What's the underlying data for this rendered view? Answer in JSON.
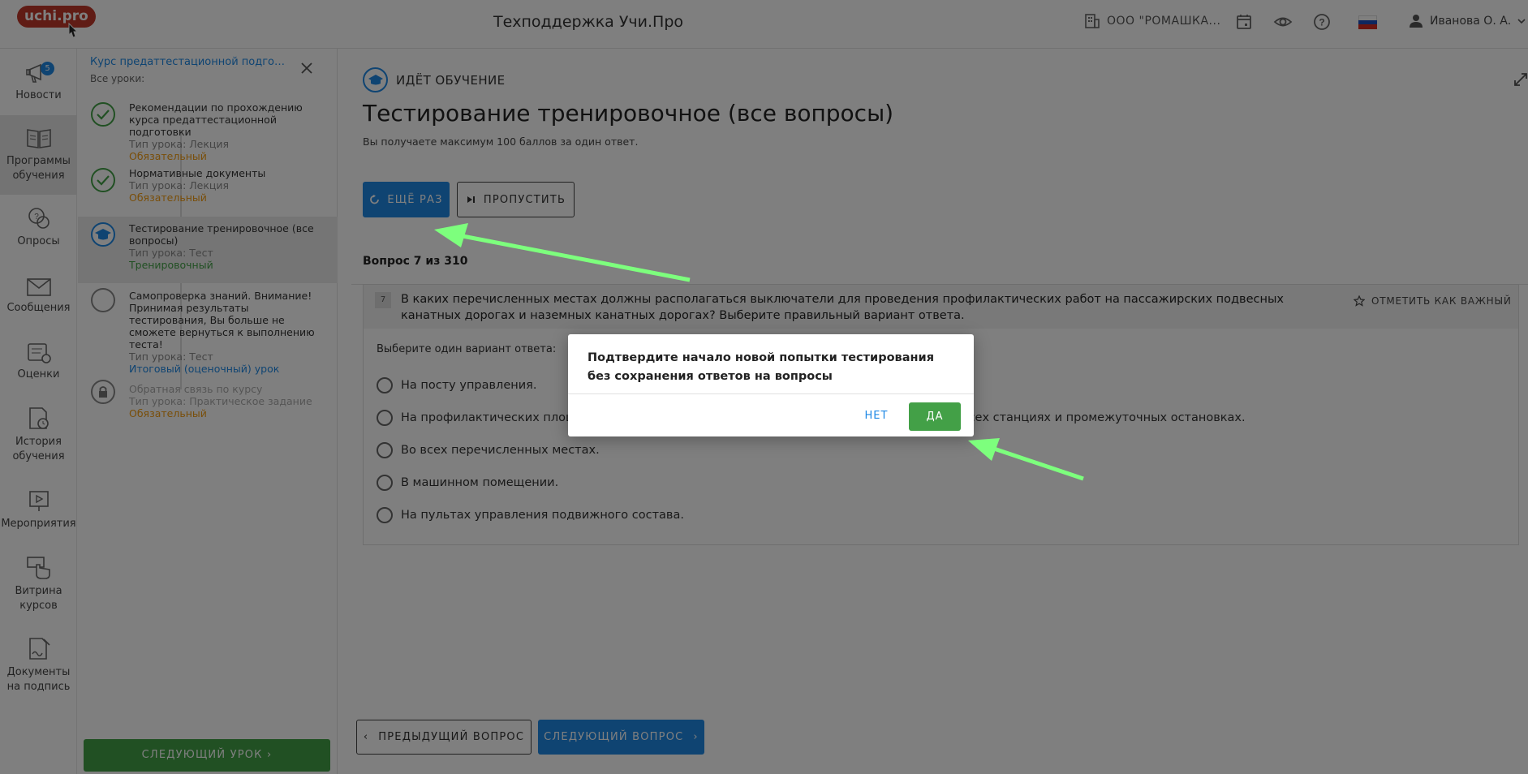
{
  "header": {
    "logo": "uchi.pro",
    "title": "Техподдержка Учи.Про",
    "org": "ООО \"РОМАШКА...",
    "user": "Иванова О. А."
  },
  "nav": {
    "news": "Новости",
    "news_badge": "5",
    "programs": "Программы обучения",
    "surveys": "Опросы",
    "messages": "Сообщения",
    "grades": "Оценки",
    "history": "История обучения",
    "events": "Мероприятия",
    "showcase": "Витрина курсов",
    "documents": "Документы на подпись"
  },
  "course": {
    "title": "Курс предаттестационной подготов...",
    "subtitle": "Все уроки:",
    "lessons": [
      {
        "title": "Рекомендации по прохождению курса предаттестационной подготовки",
        "type": "Тип урока: Лекция",
        "tag": "Обязательный"
      },
      {
        "title": "Нормативные документы",
        "type": "Тип урока: Лекция",
        "tag": "Обязательный"
      },
      {
        "title": "Тестирование тренировочное (все вопросы)",
        "type": "Тип урока: Тест",
        "tag": "Тренировочный"
      },
      {
        "title": "Самопроверка знаний. Внимание! Принимая результаты тестирования, Вы больше не сможете вернуться к выполнению теста!",
        "type": "Тип урока: Тест",
        "tag": "Итоговый (оценочный) урок"
      },
      {
        "title": "Обратная связь по курсу",
        "type": "Тип урока: Практическое задание",
        "tag": "Обязательный"
      }
    ],
    "next_lesson": "СЛЕДУЮЩИЙ УРОК"
  },
  "main": {
    "status": "ИДЁТ ОБУЧЕНИЕ",
    "heading": "Тестирование тренировочное (все вопросы)",
    "subheading": "Вы получаете максимум 100 баллов за один ответ.",
    "retry": "ЕЩЁ РАЗ",
    "skip": "ПРОПУСТИТЬ",
    "counter": "Вопрос 7 из 310",
    "question_number": "7",
    "question_text": "В каких перечисленных местах должны располагаться выключатели для проведения профилактических работ на пассажирских подвесных канатных дорогах и наземных канатных дорогах? Выберите правильный вариант ответа.",
    "mark_important": "ОТМЕТИТЬ КАК ВАЖНЫЙ",
    "hint": "Выберите один вариант ответа:",
    "options": [
      "На посту управления.",
      "На профилактических площа",
      "Во всех перечисленных местах.",
      "В машинном помещении.",
      "На пультах управления подвижного состава."
    ],
    "option2_tail": "всех станциях и промежуточных остановках.",
    "prev": "ПРЕДЫДУЩИЙ ВОПРОС",
    "next": "СЛЕДУЮЩИЙ ВОПРОС"
  },
  "dialog": {
    "text": "Подтвердите начало новой попытки тестирования без сохранения ответов на вопросы",
    "no": "НЕТ",
    "yes": "ДА"
  },
  "colors": {
    "accent": "#1e88e5",
    "success": "#43a047",
    "warning": "#f39c12",
    "logo": "#c0392b",
    "annotation_arrow": "#7dff7d"
  }
}
